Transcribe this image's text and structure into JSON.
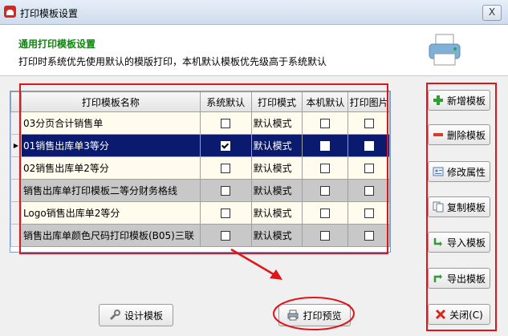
{
  "window": {
    "title": "打印模板设置",
    "close_label": "X"
  },
  "header": {
    "title": "通用打印模板设置",
    "description": "打印时系统优先使用默认的模版打印，本机默认模板优先级高于系统默认"
  },
  "table": {
    "columns": [
      "打印模板名称",
      "系统默认",
      "打印模式",
      "本机默认",
      "打印图片"
    ],
    "rows": [
      {
        "name": "03分页合计销售单",
        "system_default": false,
        "mode": "默认模式",
        "local_default": false,
        "print_image": false
      },
      {
        "name": "01销售出库单3等分",
        "system_default": true,
        "mode": "默认模式",
        "local_default": false,
        "print_image": false,
        "selected": true
      },
      {
        "name": "02销售出库单2等分",
        "system_default": false,
        "mode": "默认模式",
        "local_default": false,
        "print_image": false
      },
      {
        "name": "销售出库单打印模板二等分财务格线",
        "system_default": false,
        "mode": "默认模式",
        "local_default": false,
        "print_image": false
      },
      {
        "name": "Logo销售出库单2等分",
        "system_default": false,
        "mode": "默认模式",
        "local_default": false,
        "print_image": false
      },
      {
        "name": "销售出库单颜色尺码打印模板(B05)三联",
        "system_default": false,
        "mode": "默认模式",
        "local_default": false,
        "print_image": false
      }
    ]
  },
  "side_buttons": {
    "new": "新增模板",
    "delete": "删除模板",
    "properties": "修改属性",
    "copy": "复制模板",
    "import": "导入模板",
    "export": "导出模板",
    "close": "关闭(C)"
  },
  "bottom_buttons": {
    "design": "设计模板",
    "preview": "打印预览"
  },
  "colors": {
    "selected_row": "#0a1a6e",
    "annotation_red": "#e0151b",
    "header_title": "#0a8a0a"
  }
}
